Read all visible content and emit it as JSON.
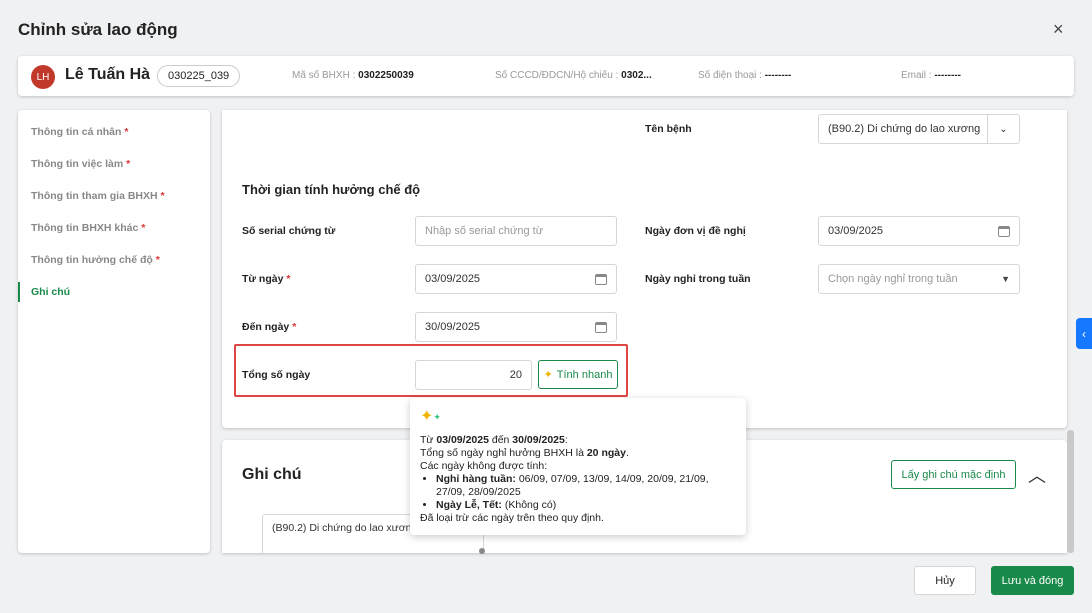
{
  "dialog": {
    "title": "Chỉnh sửa lao động",
    "close_icon": "×"
  },
  "employee": {
    "initials": "LH",
    "name": "Lê Tuấn Hà",
    "code": "030225_039",
    "bhxh_label": "Mã số BHXH : ",
    "bhxh_value": "0302250039",
    "cccd_label": "Số CCCD/ĐDCN/Hộ chiếu : ",
    "cccd_value": "0302...",
    "phone_label": "Số điện thoại : ",
    "phone_value": "--------",
    "email_label": "Email : ",
    "email_value": "--------"
  },
  "sidebar": {
    "items": [
      {
        "label": "Thông tin cá nhân",
        "req": "*"
      },
      {
        "label": "Thông tin việc làm",
        "req": "*"
      },
      {
        "label": "Thông tin tham gia BHXH",
        "req": "*"
      },
      {
        "label": "Thông tin BHXH khác",
        "req": "*"
      },
      {
        "label": "Thông tin hưởng chế độ",
        "req": "*"
      },
      {
        "label": "Ghi chú",
        "req": ""
      }
    ]
  },
  "form": {
    "disease_label": "Tên bệnh",
    "disease_value": "(B90.2) Di chứng do lao xương",
    "section_title": "Thời gian tính hưởng chế độ",
    "serial_label": "Số serial chứng từ",
    "serial_placeholder": "Nhập số serial chứng từ",
    "request_date_label": "Ngày đơn vị đề nghị",
    "request_date_value": "03/09/2025",
    "from_label": "Từ ngày",
    "from_value": "03/09/2025",
    "weekly_off_label": "Ngày nghỉ trong tuần",
    "weekly_off_placeholder": "Chọn ngày nghỉ trong tuần",
    "to_label": "Đến ngày",
    "to_value": "30/09/2025",
    "total_label": "Tổng số ngày",
    "total_value": "20",
    "quick_calc_label": "Tính nhanh",
    "required_mark": "*"
  },
  "tooltip": {
    "l1a": "Từ ",
    "l1b": "03/09/2025",
    "l1c": " đến ",
    "l1d": "30/09/2025",
    "l1e": ":",
    "l2a": "Tổng số ngày nghỉ hưởng BHXH là ",
    "l2b": "20 ngày",
    "l2c": ".",
    "l3": "Các ngày không được tính:",
    "b1_label": "Nghỉ hàng tuần:",
    "b1_value": " 06/09, 07/09, 13/09, 14/09, 20/09, 21/09, 27/09, 28/09/2025",
    "b2_label": "Ngày Lễ, Tết:",
    "b2_value": " (Không có)",
    "l4": "Đã loại trừ các ngày trên theo quy định."
  },
  "notes": {
    "title": "Ghi chú",
    "default_button": "Lấy ghi chú mặc định",
    "text": "(B90.2) Di chứng do lao xương"
  },
  "footer": {
    "cancel": "Hủy",
    "save": "Lưu và đóng"
  },
  "colors": {
    "primary": "#1a8a4a",
    "highlight": "#e04545",
    "blue_tab": "#1677ff"
  }
}
